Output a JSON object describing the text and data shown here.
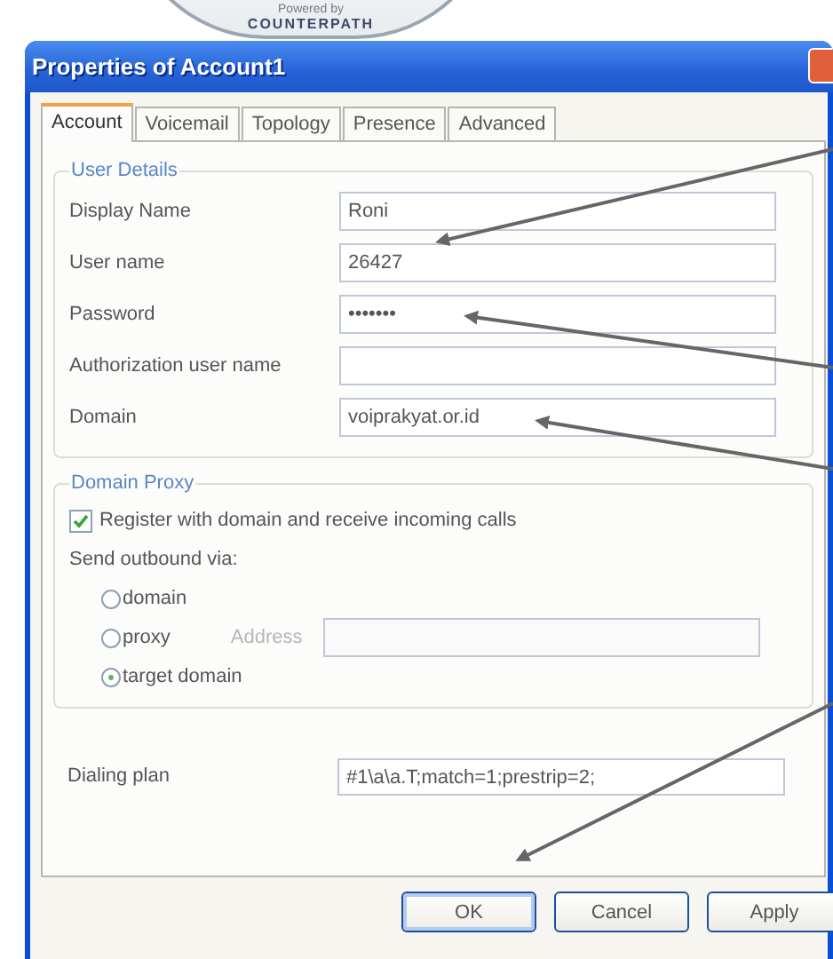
{
  "logo": {
    "caption": "Powered by",
    "brand": "COUNTERPATH"
  },
  "window": {
    "title": "Properties of Account1"
  },
  "tabs": [
    {
      "label": "Account",
      "selected": true
    },
    {
      "label": "Voicemail",
      "selected": false
    },
    {
      "label": "Topology",
      "selected": false
    },
    {
      "label": "Presence",
      "selected": false
    },
    {
      "label": "Advanced",
      "selected": false
    }
  ],
  "user_details": {
    "title": "User Details",
    "fields": [
      {
        "label": "Display Name",
        "value": "Roni"
      },
      {
        "label": "User name",
        "value": "26427"
      },
      {
        "label": "Password",
        "value": "•••••••"
      },
      {
        "label": "Authorization user name"
      },
      {
        "label": "Domain",
        "value": "voiprakyat.or.id"
      }
    ]
  },
  "domain_proxy": {
    "title": "Domain Proxy",
    "register": {
      "label": "Register with domain and receive incoming calls",
      "checked": true
    },
    "send_via": "Send outbound via:",
    "options": [
      {
        "label": "domain",
        "selected": false
      },
      {
        "label": "proxy",
        "selected": false
      },
      {
        "label": "target domain",
        "selected": true
      }
    ],
    "address": {
      "label": "Address",
      "disabled": true
    }
  },
  "dialing_plan": {
    "label": "Dialing plan",
    "value": "#1\\a\\a.T;match=1;prestrip=2;"
  },
  "buttons": [
    {
      "label": "OK",
      "default": true
    },
    {
      "label": "Cancel",
      "default": false
    },
    {
      "label": "Apply",
      "default": false
    }
  ]
}
